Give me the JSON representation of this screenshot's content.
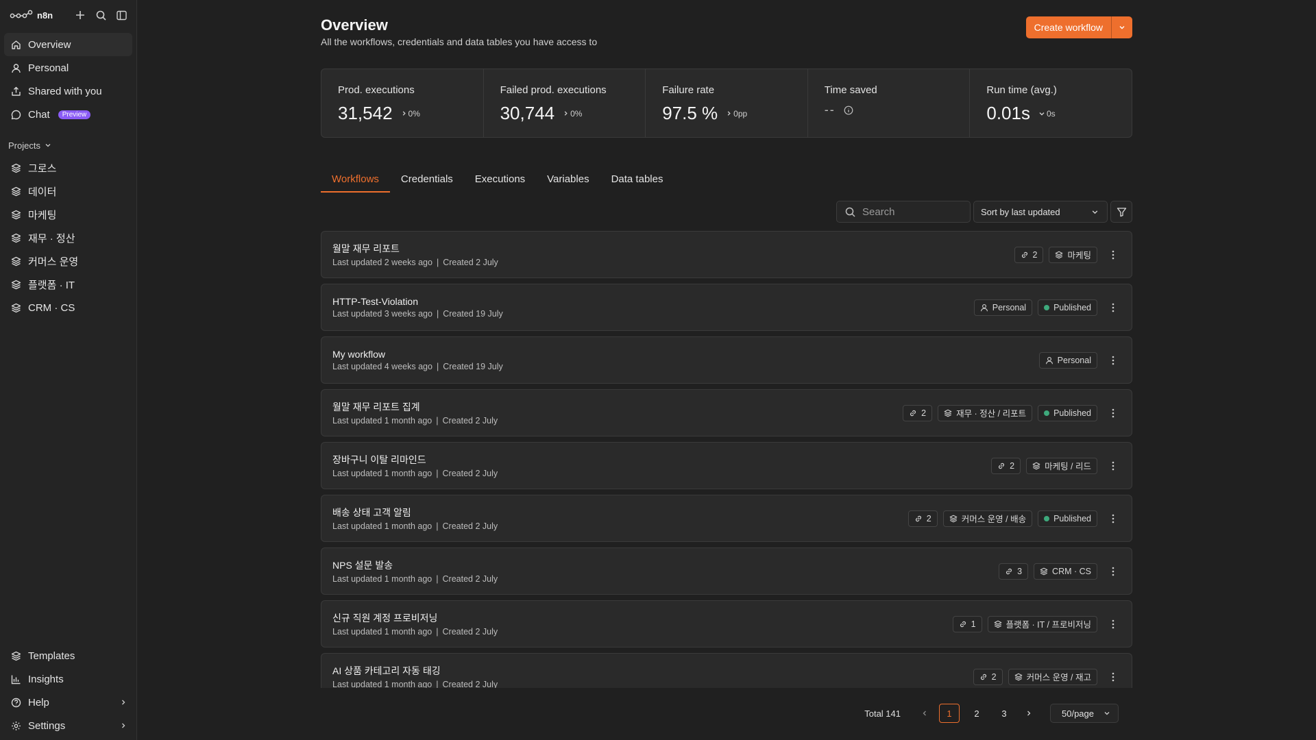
{
  "app": {
    "logo_text": "n8n",
    "accent": "#ee6f2d",
    "published_color": "#3ea97c",
    "preview_color": "#8b5cf6"
  },
  "sidebar": {
    "nav": [
      {
        "label": "Overview",
        "icon": "home-icon"
      },
      {
        "label": "Personal",
        "icon": "user-icon"
      },
      {
        "label": "Shared with you",
        "icon": "share-icon"
      },
      {
        "label": "Chat",
        "icon": "chat-icon",
        "badge": "Preview"
      }
    ],
    "projects_label": "Projects",
    "projects": [
      {
        "label": "그로스"
      },
      {
        "label": "데이터"
      },
      {
        "label": "마케팅"
      },
      {
        "label": "재무 · 정산"
      },
      {
        "label": "커머스 운영"
      },
      {
        "label": "플랫폼 · IT"
      },
      {
        "label": "CRM · CS"
      }
    ],
    "bottom": [
      {
        "label": "Templates",
        "icon": "templates-icon"
      },
      {
        "label": "Insights",
        "icon": "chart-icon"
      },
      {
        "label": "Help",
        "icon": "help-icon"
      },
      {
        "label": "Settings",
        "icon": "gear-icon"
      }
    ]
  },
  "header": {
    "title": "Overview",
    "subtitle": "All the workflows, credentials and data tables you have access to",
    "create_label": "Create workflow"
  },
  "stats": [
    {
      "label": "Prod. executions",
      "value": "31,542",
      "delta": "0%"
    },
    {
      "label": "Failed prod. executions",
      "value": "30,744",
      "delta": "0%"
    },
    {
      "label": "Failure rate",
      "value": "97.5 %",
      "delta": "0pp"
    },
    {
      "label": "Time saved",
      "value": "--"
    },
    {
      "label": "Run time (avg.)",
      "value": "0.01s",
      "delta": "0s"
    }
  ],
  "tabs": [
    "Workflows",
    "Credentials",
    "Executions",
    "Variables",
    "Data tables"
  ],
  "toolbar": {
    "search_placeholder": "Search",
    "sort_label": "Sort by last updated"
  },
  "workflows": [
    {
      "name": "월말 재무 리포트",
      "updated": "Last updated 2 weeks ago",
      "created": "Created 2 July",
      "links": "2",
      "project": "마케팅",
      "published": ""
    },
    {
      "name": "HTTP-Test-Violation",
      "updated": "Last updated 3 weeks ago",
      "created": "Created 19 July",
      "links": "",
      "project": "",
      "personal": "Personal",
      "published": "Published"
    },
    {
      "name": "My workflow",
      "updated": "Last updated 4 weeks ago",
      "created": "Created 19 July",
      "links": "",
      "project": "",
      "personal": "Personal",
      "published": ""
    },
    {
      "name": "월말 재무 리포트 집계",
      "updated": "Last updated 1 month ago",
      "created": "Created 2 July",
      "links": "2",
      "project": "재무 · 정산 / 리포트",
      "published": "Published"
    },
    {
      "name": "장바구니 이탈 리마인드",
      "updated": "Last updated 1 month ago",
      "created": "Created 2 July",
      "links": "2",
      "project": "마케팅 / 리드",
      "published": ""
    },
    {
      "name": "배송 상태 고객 알림",
      "updated": "Last updated 1 month ago",
      "created": "Created 2 July",
      "links": "2",
      "project": "커머스 운영 / 배송",
      "published": "Published"
    },
    {
      "name": "NPS 설문 발송",
      "updated": "Last updated 1 month ago",
      "created": "Created 2 July",
      "links": "3",
      "project": "CRM · CS",
      "published": ""
    },
    {
      "name": "신규 직원 계정 프로비저닝",
      "updated": "Last updated 1 month ago",
      "created": "Created 2 July",
      "links": "1",
      "project": "플랫폼 · IT / 프로비저닝",
      "published": ""
    },
    {
      "name": "AI 상품 카테고리 자동 태깅",
      "updated": "Last updated 1 month ago",
      "created": "Created 2 July",
      "links": "2",
      "project": "커머스 운영 / 재고",
      "published": ""
    }
  ],
  "pagination": {
    "total": "Total 141",
    "pages": [
      "1",
      "2",
      "3"
    ],
    "current": "1",
    "per_page": "50/page"
  }
}
